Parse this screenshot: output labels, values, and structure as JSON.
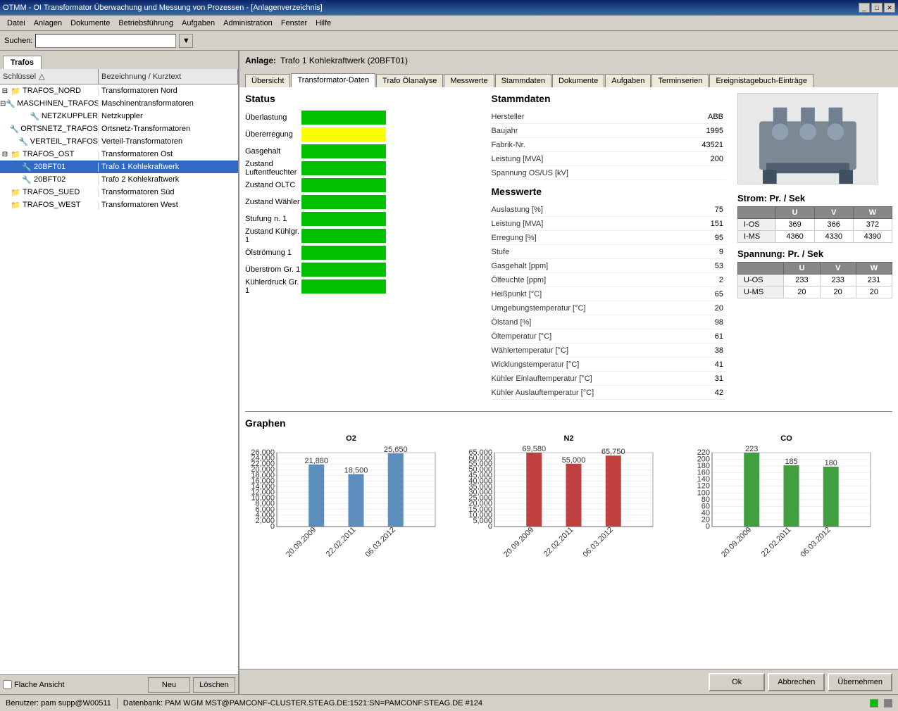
{
  "titlebar": {
    "title": "OTMM - OI Transformator Überwachung und Messung von Prozessen - [Anlagenverzeichnis]",
    "btn_minimize": "_",
    "btn_restore": "□",
    "btn_close": "✕"
  },
  "menubar": {
    "items": [
      "Datei",
      "Anlagen",
      "Dokumente",
      "Betriebsführung",
      "Aufgaben",
      "Administration",
      "Fenster",
      "Hilfe"
    ]
  },
  "search": {
    "label": "Suchen:",
    "placeholder": ""
  },
  "left_panel": {
    "tab": "Trafos",
    "col_schluessel": "Schlüssel",
    "col_bezeichnung": "Bezeichnung / Kurztext",
    "tree": [
      {
        "id": "TRAFOS_NORD",
        "level": 1,
        "expanded": true,
        "label": "TRAFOS_NORD",
        "desc": "Transformatoren Nord"
      },
      {
        "id": "MASCHINEN_TRAFOS",
        "level": 2,
        "expanded": true,
        "label": "MASCHINEN_TRAFOS",
        "desc": "Maschinentransformatoren"
      },
      {
        "id": "NETZKUPPLER",
        "level": 3,
        "label": "NETZKUPPLER",
        "desc": "Netzkuppler"
      },
      {
        "id": "ORTSNETZ_TRAFOS",
        "level": 3,
        "label": "ORTSNETZ_TRAFOS",
        "desc": "Ortsnetz-Transformatoren"
      },
      {
        "id": "VERTEIL_TRAFOS",
        "level": 3,
        "label": "VERTEIL_TRAFOS",
        "desc": "Verteil-Transformatoren"
      },
      {
        "id": "TRAFOS_OST",
        "level": 1,
        "expanded": true,
        "label": "TRAFOS_OST",
        "desc": "Transformatoren Ost"
      },
      {
        "id": "20BFT01",
        "level": 2,
        "selected": true,
        "label": "20BFT01",
        "desc": "Trafo 1 Kohlekraftwerk"
      },
      {
        "id": "20BFT02",
        "level": 2,
        "label": "20BFT02",
        "desc": "Trafo 2 Kohlekraftwerk"
      },
      {
        "id": "TRAFOS_SUED",
        "level": 1,
        "label": "TRAFOS_SUED",
        "desc": "Transformatoren Süd"
      },
      {
        "id": "TRAFOS_WEST",
        "level": 1,
        "label": "TRAFOS_WEST",
        "desc": "Transformatoren West"
      }
    ],
    "footer": {
      "checkbox_label": "Flache Ansicht",
      "btn_neu": "Neu",
      "btn_loeschen": "Löschen"
    }
  },
  "right_panel": {
    "anlage_label": "Anlage:",
    "anlage_value": "Trafo 1 Kohlekraftwerk (20BFT01)",
    "tabs": [
      "Übersicht",
      "Transformator-Daten",
      "Trafo Ölanalyse",
      "Messwerte",
      "Stammdaten",
      "Dokumente",
      "Aufgaben",
      "Terminserien",
      "Ereignistagebuch-Einträge"
    ],
    "active_tab": "Transformator-Daten",
    "status": {
      "title": "Status",
      "items": [
        {
          "label": "Überlastung",
          "color": "green"
        },
        {
          "label": "Übererregung",
          "color": "yellow"
        },
        {
          "label": "Gasgehalt",
          "color": "green"
        },
        {
          "label": "Zustand Luftentfeuchter",
          "color": "green"
        },
        {
          "label": "Zustand OLTC",
          "color": "green"
        },
        {
          "label": "Zustand Wähler",
          "color": "green"
        },
        {
          "label": "Stufung n. 1",
          "color": "green"
        },
        {
          "label": "Zustand Kühlgr. 1",
          "color": "green"
        },
        {
          "label": "Ölströmung 1",
          "color": "green"
        },
        {
          "label": "Überstrom Gr. 1",
          "color": "green"
        },
        {
          "label": "Kühlerdruck Gr. 1",
          "color": "green"
        }
      ]
    },
    "stammdaten": {
      "title": "Stammdaten",
      "items": [
        {
          "label": "Hersteller",
          "value": "ABB"
        },
        {
          "label": "Baujahr",
          "value": "1995"
        },
        {
          "label": "Fabrik-Nr.",
          "value": "43521"
        },
        {
          "label": "Leistung [MVA]",
          "value": "200"
        },
        {
          "label": "Spannung OS/US [kV]",
          "value": ""
        }
      ]
    },
    "messwerte": {
      "title": "Messwerte",
      "items": [
        {
          "label": "Auslastung [%]",
          "value": "75"
        },
        {
          "label": "Leistung [MVA]",
          "value": "151"
        },
        {
          "label": "Erregung [%]",
          "value": "95"
        },
        {
          "label": "Stufe",
          "value": "9"
        },
        {
          "label": "Gasgehalt [ppm]",
          "value": "53"
        },
        {
          "label": "Ölfeuchte [ppm]",
          "value": "2"
        },
        {
          "label": "Heißpunkt [°C]",
          "value": "65"
        },
        {
          "label": "Umgebungstemperatur [°C]",
          "value": "20"
        },
        {
          "label": "Ölstand [%]",
          "value": "98"
        },
        {
          "label": "Öltemperatur [°C]",
          "value": "61"
        },
        {
          "label": "Wählertemperatur [°C]",
          "value": "38"
        },
        {
          "label": "Wicklungstemperatur [°C]",
          "value": "41"
        },
        {
          "label": "Kühler Einlauftemperatur [°C]",
          "value": "31"
        },
        {
          "label": "Kühler Auslauftemperatur [°C]",
          "value": "42"
        }
      ]
    },
    "strom": {
      "title": "Strom: Pr. / Sek",
      "cols": [
        "",
        "U",
        "V",
        "W"
      ],
      "rows": [
        {
          "label": "I-OS",
          "u": "369",
          "v": "366",
          "w": "372"
        },
        {
          "label": "I-MS",
          "u": "4360",
          "v": "4330",
          "w": "4390"
        }
      ]
    },
    "spannung": {
      "title": "Spannung: Pr. / Sek",
      "cols": [
        "",
        "U",
        "V",
        "W"
      ],
      "rows": [
        {
          "label": "U-OS",
          "u": "233",
          "v": "233",
          "w": "231"
        },
        {
          "label": "U-MS",
          "u": "20",
          "v": "20",
          "w": "20"
        }
      ]
    },
    "graphen": {
      "title": "Graphen",
      "charts": [
        {
          "title": "O2",
          "color": "blue",
          "y_labels": [
            "26,000",
            "24,000",
            "22,000",
            "20,000",
            "18,000",
            "16,000",
            "14,000",
            "12,000",
            "10,000",
            "8,000",
            "6,000",
            "4,000",
            "2,000",
            "0"
          ],
          "bars": [
            {
              "value": 21880,
              "label": "21,880",
              "date": "20.09.2009",
              "height_pct": 84
            },
            {
              "value": 18500,
              "label": "18,500",
              "date": "22.02.2011",
              "height_pct": 71
            },
            {
              "value": 25650,
              "label": "25,650",
              "date": "06.03.2012",
              "height_pct": 99
            }
          ]
        },
        {
          "title": "N2",
          "color": "red",
          "y_labels": [
            "65,000",
            "60,000",
            "55,000",
            "50,000",
            "45,000",
            "40,000",
            "35,000",
            "30,000",
            "25,000",
            "20,000",
            "15,000",
            "10,000",
            "5,000",
            "0"
          ],
          "bars": [
            {
              "value": 69580,
              "label": "69,580",
              "date": "20.09.2009",
              "height_pct": 100
            },
            {
              "value": 55000,
              "label": "55,000",
              "date": "22.02.2011",
              "height_pct": 85
            },
            {
              "value": 65750,
              "label": "65,750",
              "date": "06.03.2012",
              "height_pct": 96
            }
          ]
        },
        {
          "title": "CO",
          "color": "green",
          "y_labels": [
            "220",
            "200",
            "180",
            "160",
            "140",
            "120",
            "100",
            "80",
            "60",
            "40",
            "20",
            "0"
          ],
          "bars": [
            {
              "value": 223,
              "label": "223",
              "date": "20.09.2009",
              "height_pct": 100
            },
            {
              "value": 185,
              "label": "185",
              "date": "22.02.2011",
              "height_pct": 83
            },
            {
              "value": 180,
              "label": "180",
              "date": "06.03.2012",
              "height_pct": 81
            }
          ]
        }
      ]
    }
  },
  "bottom_buttons": {
    "ok": "Ok",
    "abbrechen": "Abbrechen",
    "uebernehmen": "Übernehmen"
  },
  "statusbar": {
    "user": "Benutzer: pam supp@W00511",
    "db": "Datenbank: PAM WGM MST@PAMCONF-CLUSTER.STEAG.DE:1521:SN=PAMCONF.STEAG.DE #124"
  }
}
